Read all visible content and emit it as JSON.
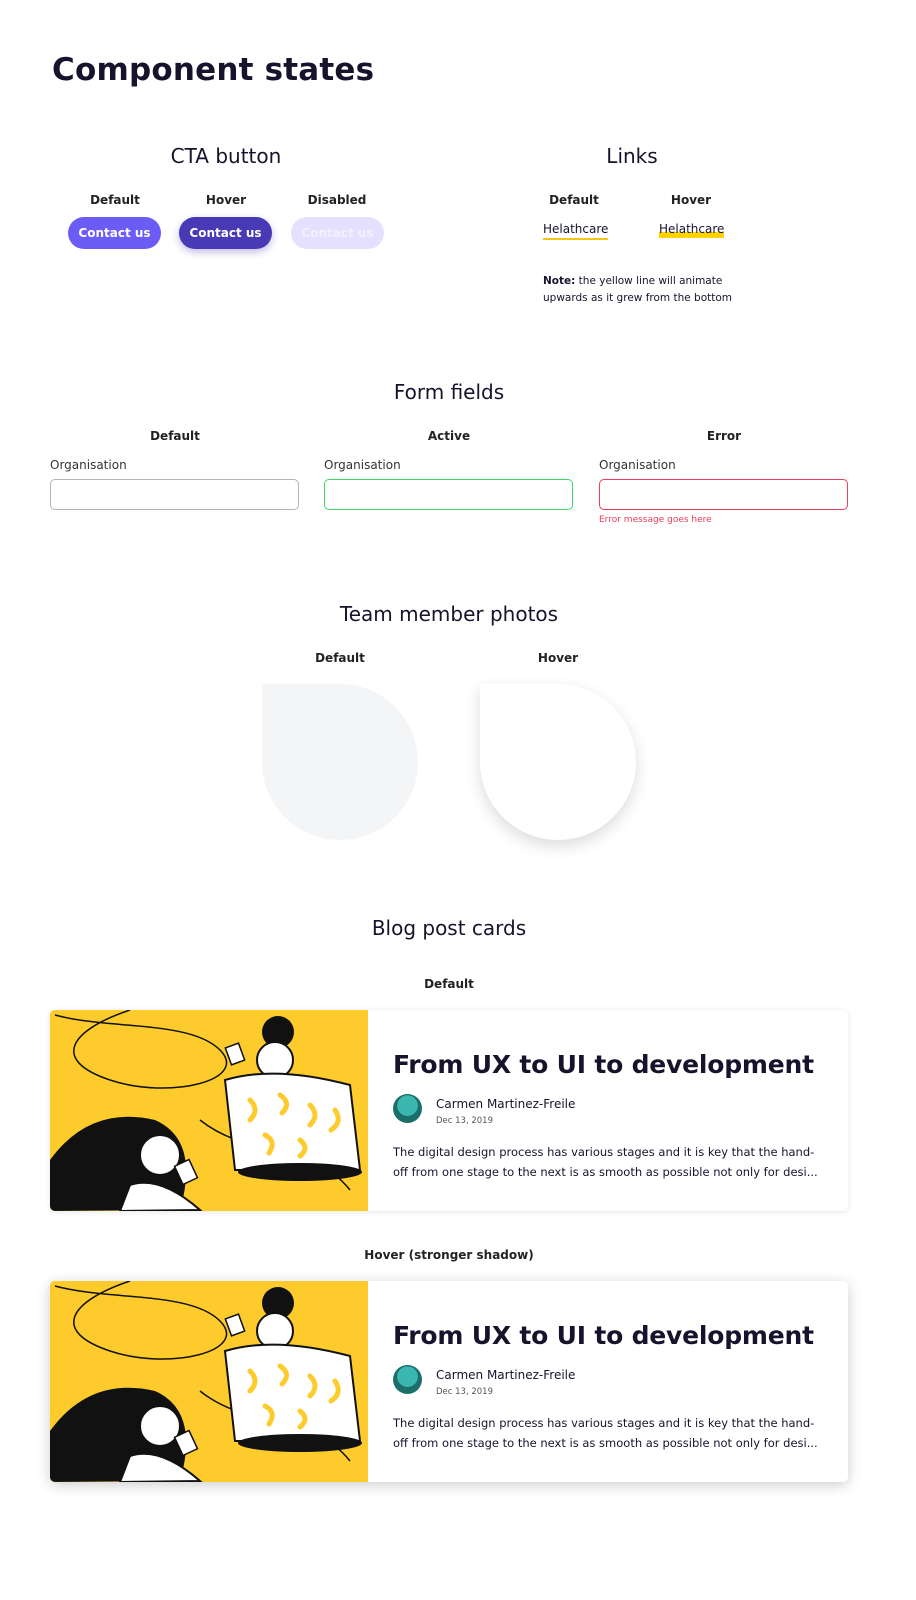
{
  "page": {
    "title": "Component states"
  },
  "cta": {
    "section_title": "CTA button",
    "states": {
      "default": "Default",
      "hover": "Hover",
      "disabled": "Disabled"
    },
    "button_label": "Contact us",
    "colors": {
      "default": "#6c5cf6",
      "hover": "#4839b5",
      "disabled": "#e4e0fd"
    }
  },
  "links": {
    "section_title": "Links",
    "states": {
      "default": "Default",
      "hover": "Hover"
    },
    "link_text": "Helathcare",
    "note_bold": "Note:",
    "note_text": " the yellow line will animate upwards as it grew from the bottom",
    "underline_color": "#ffd300"
  },
  "form": {
    "section_title": "Form fields",
    "states": {
      "default": "Default",
      "active": "Active",
      "error": "Error"
    },
    "field_label": "Organisation",
    "error_message": "Error message goes here",
    "colors": {
      "active": "#41d46b",
      "error": "#ef3c5c"
    }
  },
  "team": {
    "section_title": "Team member photos",
    "states": {
      "default": "Default",
      "hover": "Hover"
    }
  },
  "blog": {
    "section_title": "Blog post cards",
    "states": {
      "default": "Default",
      "hover": "Hover (stronger shadow)"
    },
    "card": {
      "title": "From UX to UI to development",
      "author": "Carmen Martinez-Freile",
      "date": "Dec 13, 2019",
      "excerpt_line1": "The digital design process has various stages and it is key that the hand-",
      "excerpt_line2": "off from one stage to the next is as smooth as possible not only for desi...",
      "illustration_bg": "#fdcb2c"
    }
  }
}
